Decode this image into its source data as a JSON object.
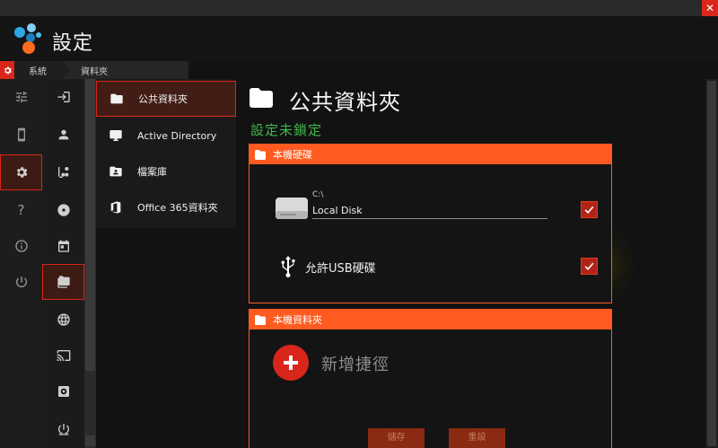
{
  "window": {
    "close_glyph": "✕"
  },
  "app": {
    "title": "設定"
  },
  "breadcrumb": {
    "items": [
      "系統",
      "資料夾"
    ]
  },
  "rail1": {
    "items": [
      {
        "icon": "sliders-icon"
      },
      {
        "icon": "mobile-icon"
      },
      {
        "icon": "gear-icon",
        "active": true
      },
      {
        "icon": "help-icon",
        "glyph": "?"
      },
      {
        "icon": "info-icon"
      },
      {
        "icon": "power-icon"
      }
    ]
  },
  "rail2": {
    "items": [
      {
        "icon": "login-icon"
      },
      {
        "icon": "person-icon"
      },
      {
        "icon": "group-icon"
      },
      {
        "icon": "disc-icon"
      },
      {
        "icon": "calendar-icon"
      },
      {
        "icon": "folders-icon",
        "selected": true
      },
      {
        "icon": "globe-icon"
      },
      {
        "icon": "cast-icon"
      },
      {
        "icon": "plugin-icon"
      },
      {
        "icon": "shutdown-icon"
      }
    ]
  },
  "sub_menu": {
    "items": [
      {
        "label": "公共資料夾",
        "icon": "folder-icon",
        "active": true
      },
      {
        "label": "Active Directory",
        "icon": "monitor-icon"
      },
      {
        "label": "檔案庫",
        "icon": "contact-folder-icon"
      },
      {
        "label": "Office 365資料夾",
        "icon": "office-icon"
      }
    ]
  },
  "main": {
    "title": "公共資料夾",
    "status": "設定未鎖定",
    "local_disk_section": {
      "heading": "本機硬碟",
      "disk_path": "C:\\",
      "disk_name": "Local Disk",
      "disk_checked": true,
      "usb_label": "允許USB硬碟",
      "usb_checked": true
    },
    "local_folder_section": {
      "heading": "本機資料夾",
      "add_shortcut_label": "新增捷徑"
    },
    "footer": {
      "save_label": "儲存",
      "reset_label": "重設"
    }
  },
  "colors": {
    "accent": "#ff5a1f",
    "brand_red": "#d8261a",
    "status_green": "#3fb84a",
    "background": "#121212"
  }
}
